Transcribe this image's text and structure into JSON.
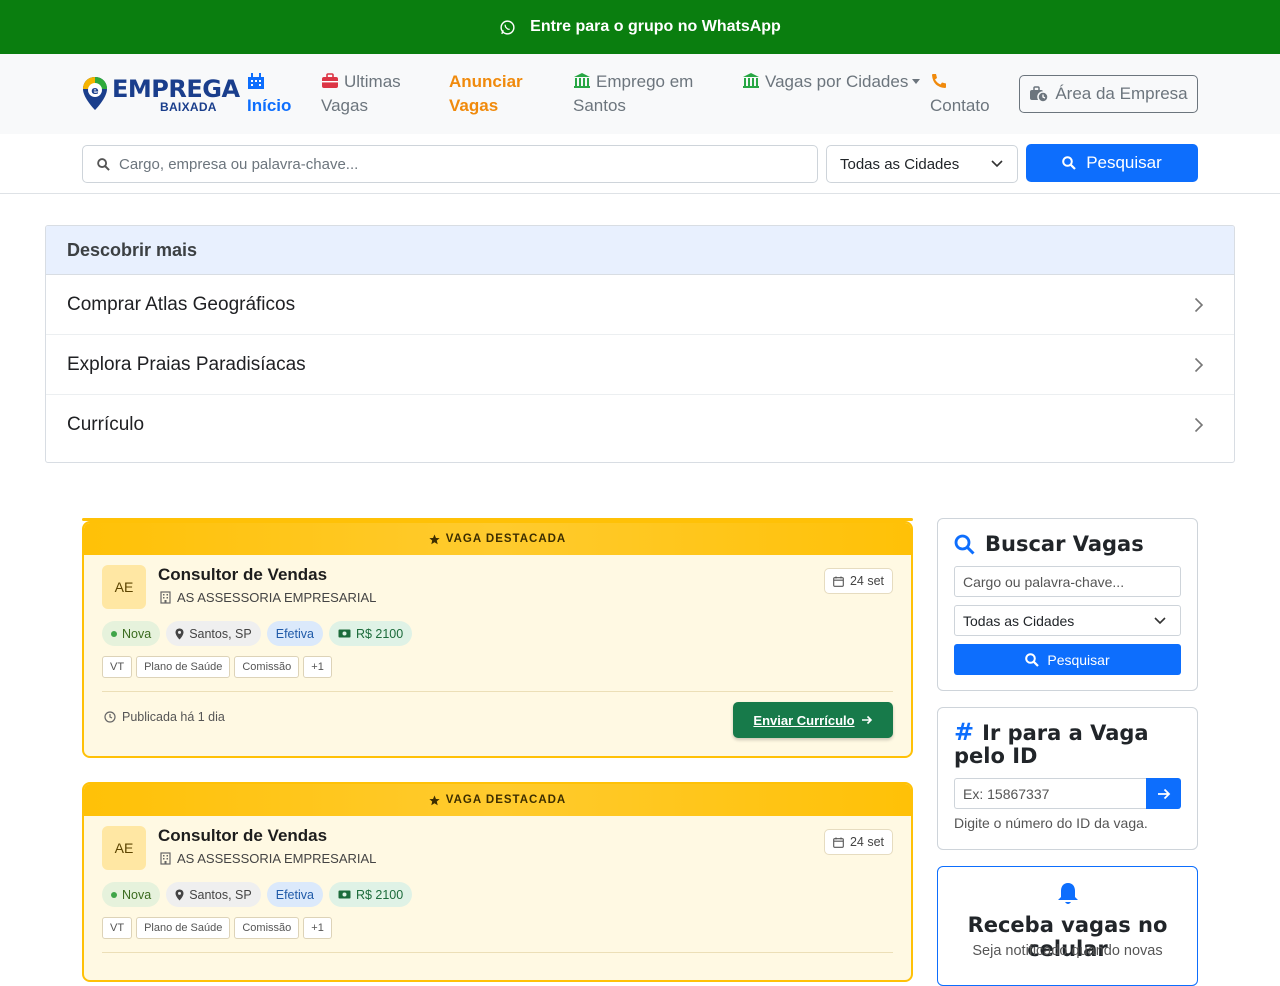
{
  "banner": {
    "text": "Entre para o grupo no WhatsApp"
  },
  "logo": {
    "line1": "EMPREGA",
    "line2": "BAIXADA"
  },
  "nav": {
    "home": "Início",
    "ultimas": "Ultimas Vagas",
    "anunciar": "Anunciar Vagas",
    "santos": "Emprego em Santos",
    "cidades": "Vagas por Cidades",
    "contato": "Contato",
    "area": "Área da Empresa"
  },
  "search": {
    "placeholder": "Cargo, empresa ou palavra-chave...",
    "city": "Todas as Cidades",
    "button": "Pesquisar"
  },
  "discover": {
    "title": "Descobrir mais",
    "items": [
      "Comprar Atlas Geográficos",
      "Explora Praias Paradisíacas",
      "Currículo"
    ]
  },
  "jobs": [
    {
      "featured": "VAGA DESTACADA",
      "initials": "AE",
      "title": "Consultor de Vendas",
      "company": "AS ASSESSORIA EMPRESARIAL",
      "date": "24 set",
      "tags": {
        "new": "Nova",
        "location": "Santos, SP",
        "type": "Efetiva",
        "salary": "R$ 2100"
      },
      "benefits": [
        "VT",
        "Plano de Saúde",
        "Comissão",
        "+1"
      ],
      "published": "Publicada há 1 dia",
      "apply": "Enviar Currículo"
    },
    {
      "featured": "VAGA DESTACADA",
      "initials": "AE",
      "title": "Consultor de Vendas",
      "company": "AS ASSESSORIA EMPRESARIAL",
      "date": "24 set",
      "tags": {
        "new": "Nova",
        "location": "Santos, SP",
        "type": "Efetiva",
        "salary": "R$ 2100"
      },
      "benefits": [
        "VT",
        "Plano de Saúde",
        "Comissão",
        "+1"
      ]
    }
  ],
  "sidebar": {
    "search": {
      "title": "Buscar Vagas",
      "placeholder": "Cargo ou palavra-chave...",
      "city": "Todas as Cidades",
      "button": "Pesquisar"
    },
    "byid": {
      "title": "Ir para a Vaga pelo ID",
      "placeholder": "Ex: 15867337",
      "hint": "Digite o número do ID da vaga."
    },
    "notify": {
      "title": "Receba vagas no celular",
      "subtitle": "Seja notificado quando novas"
    }
  },
  "colors": {
    "whatsapp_green": "#0a7e0f",
    "primary": "#0d6efd",
    "accent_orange": "#f08a0c",
    "featured_gold": "#ffc107",
    "apply_green": "#177a4a"
  }
}
